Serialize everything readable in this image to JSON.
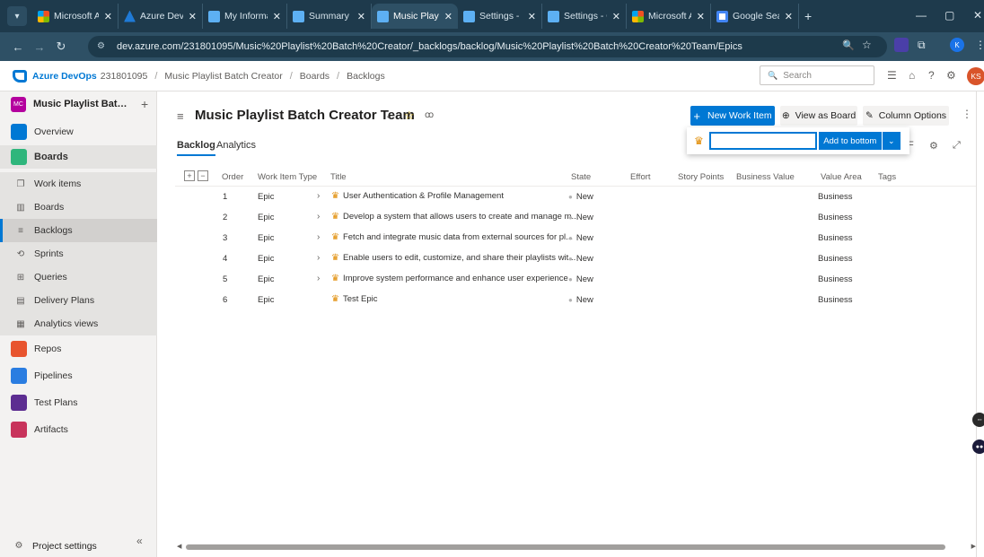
{
  "browser": {
    "tabs": [
      {
        "title": "Microsoft Az",
        "icon": "ms"
      },
      {
        "title": "Azure DevOp",
        "icon": "azure"
      },
      {
        "title": "My Informati",
        "icon": "ado"
      },
      {
        "title": "Summary - C",
        "icon": "ado"
      },
      {
        "title": "Music Playlis",
        "icon": "ado",
        "active": true
      },
      {
        "title": "Settings - Pro",
        "icon": "ado"
      },
      {
        "title": "Settings - Ov",
        "icon": "ado"
      },
      {
        "title": "Microsoft Az",
        "icon": "ms"
      },
      {
        "title": "Google Sear",
        "icon": "google"
      }
    ],
    "url": "dev.azure.com/231801095/Music%20Playlist%20Batch%20Creator/_backlogs/backlog/Music%20Playlist%20Batch%20Creator%20Team/Epics",
    "profile_letter": "K"
  },
  "header": {
    "brand": "Azure DevOps",
    "org": "231801095",
    "project": "Music Playlist Batch Creator",
    "section": "Boards",
    "page": "Backlogs",
    "search_placeholder": "Search",
    "avatar_initials": "KS"
  },
  "sidebar": {
    "project_badge": "MC",
    "project_name": "Music Playlist Batch Creator",
    "items": [
      {
        "label": "Overview",
        "kind": "top",
        "icon": "overview-icon",
        "color": "#0078d4"
      },
      {
        "label": "Boards",
        "kind": "group",
        "icon": "boards-icon",
        "color": "#2fb67c"
      },
      {
        "label": "Work items",
        "kind": "sub",
        "icon": "work-items-icon"
      },
      {
        "label": "Boards",
        "kind": "sub",
        "icon": "board-icon"
      },
      {
        "label": "Backlogs",
        "kind": "sub",
        "icon": "backlogs-icon",
        "selected": true
      },
      {
        "label": "Sprints",
        "kind": "sub",
        "icon": "sprints-icon"
      },
      {
        "label": "Queries",
        "kind": "sub",
        "icon": "queries-icon"
      },
      {
        "label": "Delivery Plans",
        "kind": "sub",
        "icon": "delivery-plans-icon"
      },
      {
        "label": "Analytics views",
        "kind": "sub",
        "icon": "analytics-icon"
      },
      {
        "label": "Repos",
        "kind": "top",
        "icon": "repos-icon",
        "color": "#e8542e"
      },
      {
        "label": "Pipelines",
        "kind": "top",
        "icon": "pipelines-icon",
        "color": "#2a7de1"
      },
      {
        "label": "Test Plans",
        "kind": "top",
        "icon": "test-plans-icon",
        "color": "#5c2d91"
      },
      {
        "label": "Artifacts",
        "kind": "top",
        "icon": "artifacts-icon",
        "color": "#c8345c"
      }
    ],
    "project_settings": "Project settings"
  },
  "main": {
    "team_title": "Music Playlist Batch Creator Team",
    "tabs": [
      "Backlog",
      "Analytics"
    ],
    "new_work_item": "New Work Item",
    "view_as_board": "View as Board",
    "column_options": "Column Options",
    "add_popup": {
      "input_value": "",
      "add_button": "Add to bottom"
    },
    "columns": [
      "Order",
      "Work Item Type",
      "Title",
      "State",
      "Effort",
      "Story Points",
      "Business Value",
      "Value Area",
      "Tags"
    ],
    "rows": [
      {
        "order": "1",
        "type": "Epic",
        "title": "User Authentication & Profile Management",
        "state": "New",
        "value_area": "Business",
        "expandable": true
      },
      {
        "order": "2",
        "type": "Epic",
        "title": "Develop a system that allows users to create and manage m...",
        "state": "New",
        "value_area": "Business",
        "expandable": true
      },
      {
        "order": "3",
        "type": "Epic",
        "title": "Fetch and integrate music data from external sources for pl...",
        "state": "New",
        "value_area": "Business",
        "expandable": true
      },
      {
        "order": "4",
        "type": "Epic",
        "title": "Enable users to edit, customize, and share their playlists wit...",
        "state": "New",
        "value_area": "Business",
        "expandable": true
      },
      {
        "order": "5",
        "type": "Epic",
        "title": "Improve system performance and enhance user experience",
        "state": "New",
        "value_area": "Business",
        "expandable": true
      },
      {
        "order": "6",
        "type": "Epic",
        "title": "Test Epic",
        "state": "New",
        "value_area": "Business",
        "expandable": false
      }
    ]
  }
}
